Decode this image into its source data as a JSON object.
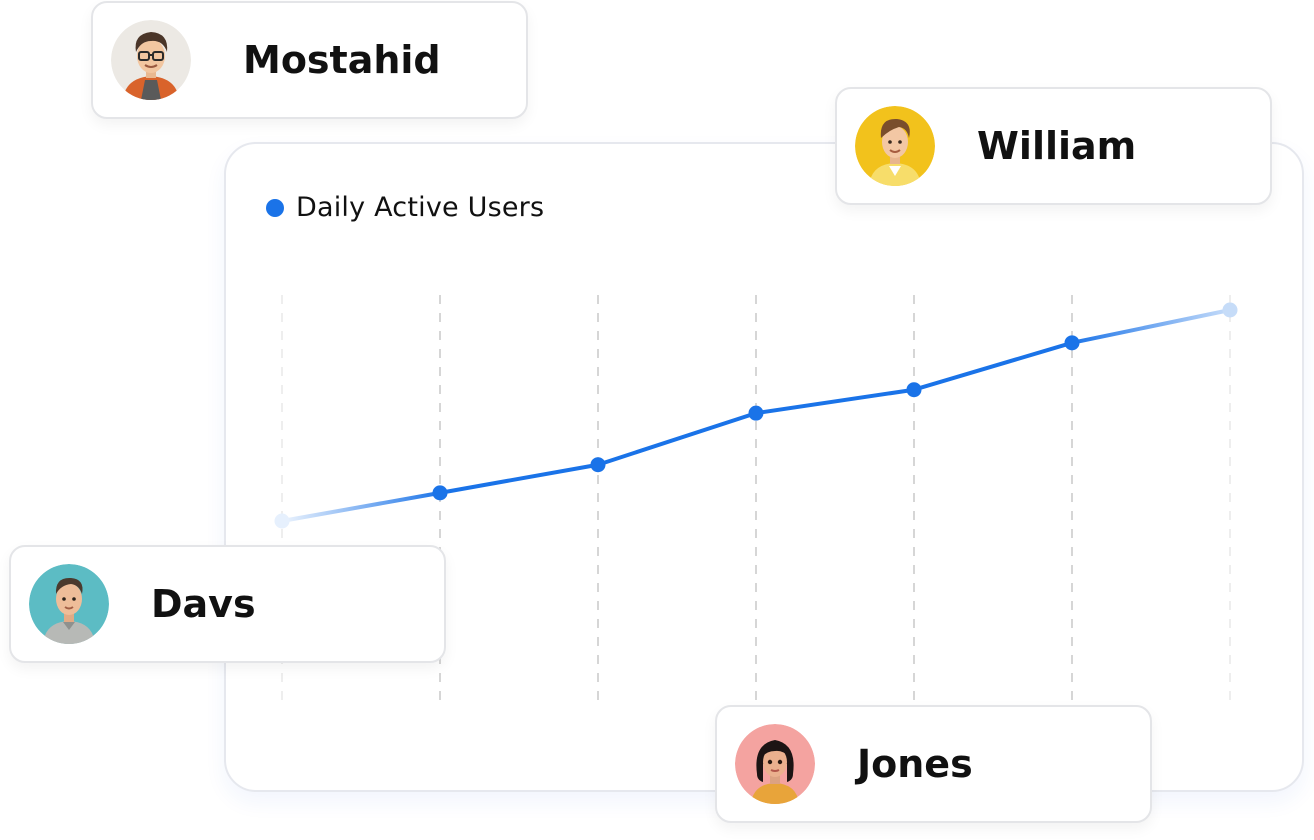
{
  "chart_data": {
    "type": "line",
    "series": [
      {
        "name": "Daily Active Users",
        "color": "#1a73e8",
        "values": [
          2.0,
          2.6,
          3.2,
          4.3,
          4.8,
          5.8,
          6.5
        ]
      }
    ],
    "x": [
      1,
      2,
      3,
      4,
      5,
      6,
      7
    ],
    "ylim": [
      0,
      7
    ],
    "grid": "vertical-dashed",
    "legend": "top-left"
  },
  "users": [
    {
      "id": "mostahid",
      "name": "Mostahid",
      "avatar_bg": "#ece9e4",
      "hair": "#4a3528",
      "skin": "#f2c6a0",
      "shirt": "#d9632b",
      "glasses": true
    },
    {
      "id": "william",
      "name": "William",
      "avatar_bg": "#f2c21c",
      "hair": "#7a4e2c",
      "skin": "#f3c7a4",
      "shirt": "#f4d03f"
    },
    {
      "id": "davs",
      "name": "Davs",
      "avatar_bg": "#5cbcc4",
      "hair": "#4b3a2e",
      "skin": "#eebd99",
      "shirt": "#b7b9b6"
    },
    {
      "id": "jones",
      "name": "Jones",
      "avatar_bg": "#f4a3a0",
      "hair": "#1c1414",
      "skin": "#eab08e",
      "shirt": "#e8a43a"
    }
  ]
}
